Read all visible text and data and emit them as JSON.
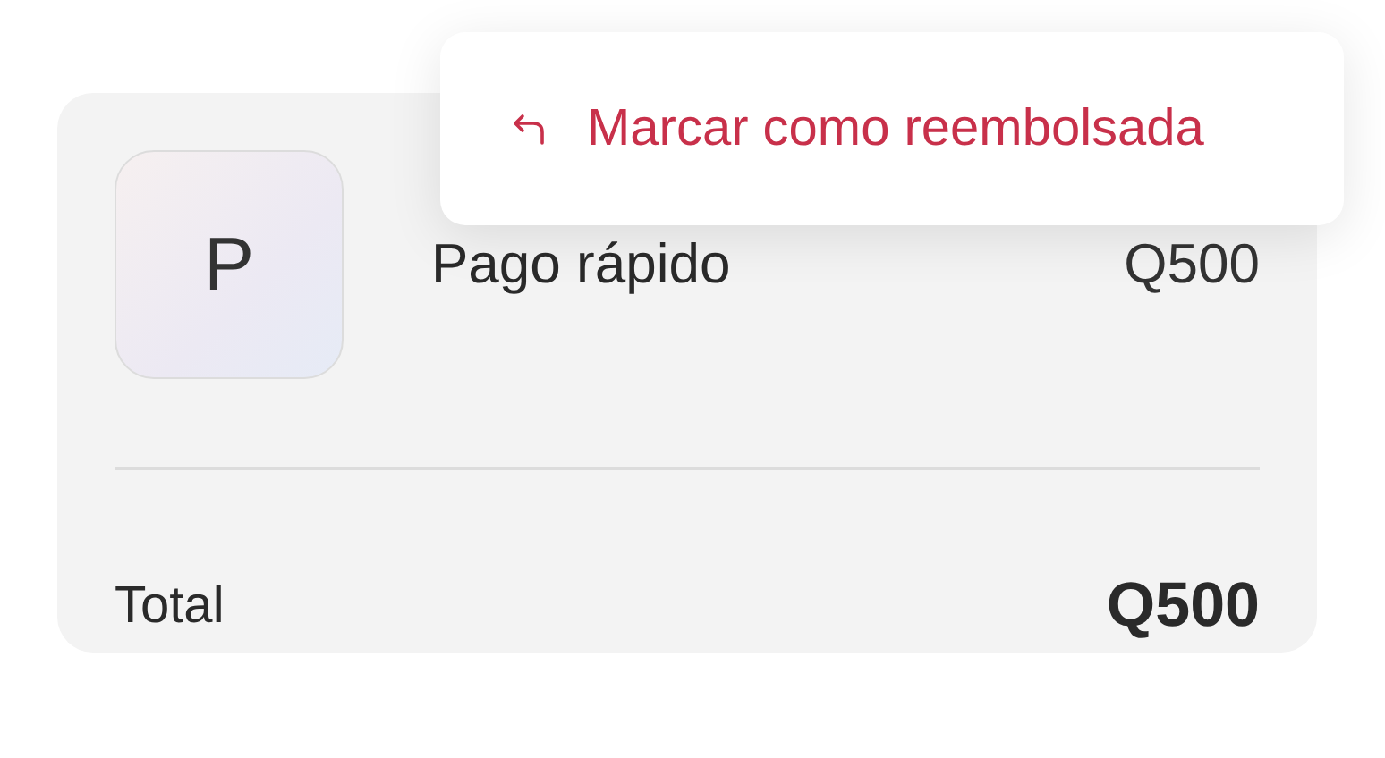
{
  "item": {
    "avatar": "P",
    "name": "Pago rápido",
    "amount": "Q500"
  },
  "total": {
    "label": "Total",
    "amount": "Q500"
  },
  "menu": {
    "items": [
      {
        "label": "Marcar como reembolsada",
        "kind": "destructive"
      }
    ]
  }
}
